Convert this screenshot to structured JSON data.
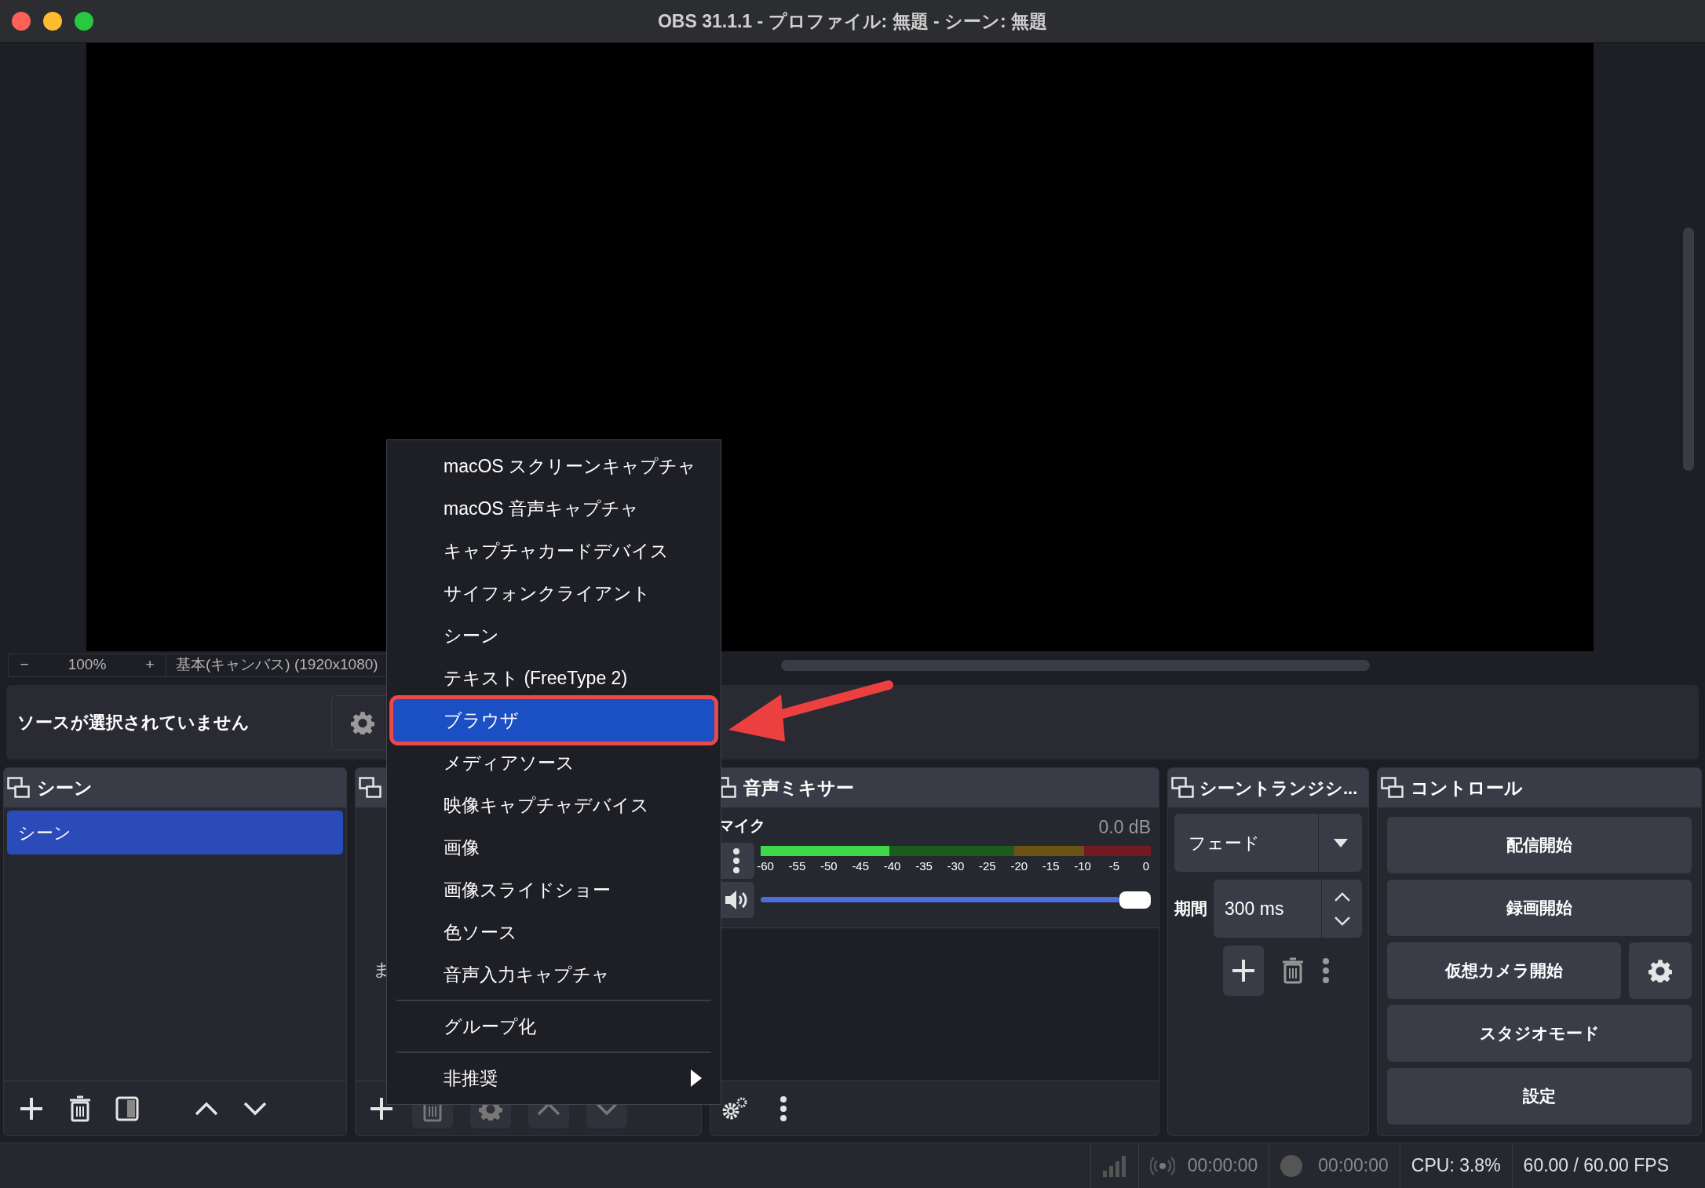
{
  "window": {
    "title": "OBS 31.1.1 - プロファイル: 無題 - シーン: 無題"
  },
  "preview_toolbar": {
    "zoom_out": "−",
    "zoom": "100%",
    "zoom_in": "+",
    "canvas": "基本(キャンバス) (1920x1080)"
  },
  "context_bar": {
    "message": "ソースが選択されていません"
  },
  "scenes": {
    "title": "シーン",
    "items": [
      {
        "label": "シーン",
        "selected": true
      }
    ]
  },
  "sources": {
    "partial_text": "ま"
  },
  "mixer": {
    "title": "音声ミキサー",
    "channels": [
      {
        "name": "マイク",
        "reading": "0.0 dB",
        "muted": false,
        "level": 1,
        "meter": {
          "level": 0.33
        }
      }
    ],
    "scale": [
      "-60",
      "-55",
      "-50",
      "-45",
      "-40",
      "-35",
      "-30",
      "-25",
      "-20",
      "-15",
      "-10",
      "-5",
      "0"
    ]
  },
  "transitions": {
    "title": "シーントランジシ...",
    "transition": "フェード",
    "duration_label": "期間",
    "duration": "300 ms"
  },
  "controls": {
    "title": "コントロール",
    "buttons": [
      {
        "label": "配信開始",
        "settings": false
      },
      {
        "label": "録画開始",
        "settings": false
      },
      {
        "label": "仮想カメラ開始",
        "settings": true
      },
      {
        "label": "スタジオモード",
        "settings": false
      },
      {
        "label": "設定",
        "settings": false
      }
    ]
  },
  "status_bar": {
    "stream_time": "00:00:00",
    "record_time": "00:00:00",
    "cpu": "CPU: 3.8%",
    "fps": "60.00 / 60.00 FPS"
  },
  "context_menu": {
    "items": [
      {
        "kind": "item",
        "label": "macOS スクリーンキャプチャ",
        "selected": false
      },
      {
        "kind": "item",
        "label": "macOS 音声キャプチャ",
        "selected": false
      },
      {
        "kind": "item",
        "label": "キャプチャカードデバイス",
        "selected": false
      },
      {
        "kind": "item",
        "label": "サイフォンクライアント",
        "selected": false
      },
      {
        "kind": "item",
        "label": "シーン",
        "selected": false
      },
      {
        "kind": "item",
        "label": "テキスト (FreeType 2)",
        "selected": false
      },
      {
        "kind": "item",
        "label": "ブラウザ",
        "selected": true
      },
      {
        "kind": "item",
        "label": "メディアソース",
        "selected": false
      },
      {
        "kind": "item",
        "label": "映像キャプチャデバイス",
        "selected": false
      },
      {
        "kind": "item",
        "label": "画像",
        "selected": false
      },
      {
        "kind": "item",
        "label": "画像スライドショー",
        "selected": false
      },
      {
        "kind": "item",
        "label": "色ソース",
        "selected": false
      },
      {
        "kind": "item",
        "label": "音声入力キャプチャ",
        "selected": false
      },
      {
        "kind": "separator"
      },
      {
        "kind": "item",
        "label": "グループ化",
        "selected": false
      },
      {
        "kind": "separator"
      },
      {
        "kind": "submenu",
        "label": "非推奨",
        "selected": false
      }
    ]
  }
}
